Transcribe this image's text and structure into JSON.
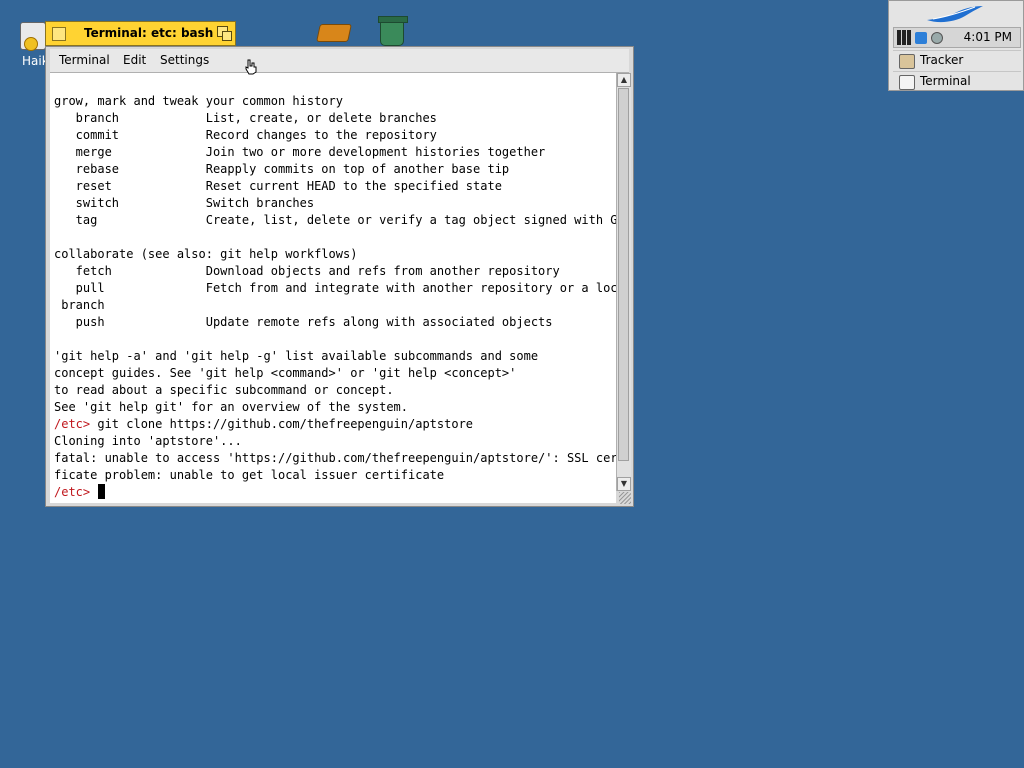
{
  "desktop": {
    "icons": [
      {
        "label": "Haik",
        "icon": "haiku-home-icon"
      },
      {
        "label": "",
        "icon": "books-icon"
      },
      {
        "label": "",
        "icon": "trash-icon"
      }
    ]
  },
  "window": {
    "title": "Terminal: etc: bash",
    "accent": "#ffd332",
    "menu": [
      "Terminal",
      "Edit",
      "Settings"
    ],
    "terminal_lines": [
      "grow, mark and tweak your common history",
      "   branch            List, create, or delete branches",
      "   commit            Record changes to the repository",
      "   merge             Join two or more development histories together",
      "   rebase            Reapply commits on top of another base tip",
      "   reset             Reset current HEAD to the specified state",
      "   switch            Switch branches",
      "   tag               Create, list, delete or verify a tag object signed with GPG",
      "",
      "collaborate (see also: git help workflows)",
      "   fetch             Download objects and refs from another repository",
      "   pull              Fetch from and integrate with another repository or a local",
      " branch",
      "   push              Update remote refs along with associated objects",
      "",
      "'git help -a' and 'git help -g' list available subcommands and some",
      "concept guides. See 'git help <command>' or 'git help <concept>'",
      "to read about a specific subcommand or concept.",
      "See 'git help git' for an overview of the system.",
      "git clone https://github.com/thefreepenguin/aptstore",
      "Cloning into 'aptstore'...",
      "fatal: unable to access 'https://github.com/thefreepenguin/aptstore/': SSL certi",
      "ficate problem: unable to get local issuer certificate",
      ""
    ],
    "prompt": "/etc>",
    "prompt_color": "#c0171d"
  },
  "deskbar": {
    "clock": "4:01 PM",
    "apps": [
      "Tracker",
      "Terminal"
    ],
    "logo": "haiku-leaf-logo"
  }
}
